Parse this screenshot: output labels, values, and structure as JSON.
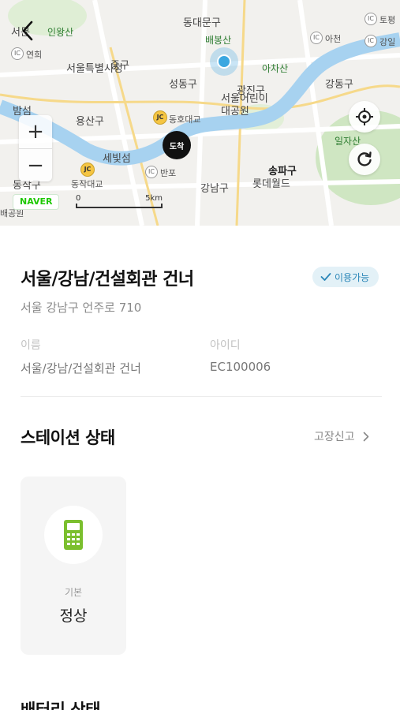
{
  "map": {
    "labels": {
      "dongdaemun": "동대문구",
      "seomun": "서문",
      "inwangsan": "인왕산",
      "baebongsan": "배봉산",
      "ic_yeonhui": "연희",
      "seoulcity": "서울특별시청",
      "junggu": "중구",
      "achasan": "아차산",
      "seongdong": "성동구",
      "gwangjingu": "광진구",
      "childpark": "서울어린이\n대공원",
      "gangdong": "강동구",
      "bamseom": "밤섬",
      "yongsan": "용산구",
      "dongho": "동호대교",
      "ilja": "일자산",
      "sebit": "세빛섬",
      "dongjak": "동작구",
      "dongjakbridge": "동작대교",
      "banpo": "반포",
      "songpa": "송파구",
      "lotteworld": "롯데월드",
      "gangnam": "강남구",
      "baegongwon": "배공원",
      "ic_ajeon": "아천",
      "ic_gangil": "강일",
      "ic_topyeong": "토평"
    },
    "arrive_label": "도착",
    "naver_label": "NAVER",
    "scale_start": "0",
    "scale_end": "5km",
    "zoom_in_label": "+",
    "zoom_out_label": "−"
  },
  "station": {
    "name": "서울/강남/건설회관 건너",
    "status_badge": "이용가능",
    "address": "서울 강남구 언주로 710",
    "name_label": "이름",
    "name_value": "서울/강남/건설회관 건너",
    "id_label": "아이디",
    "id_value": "EC100006"
  },
  "station_status": {
    "title": "스테이션 상태",
    "report_label": "고장신고",
    "card_label": "기본",
    "card_value": "정상"
  },
  "battery_section": {
    "title": "배터리 상태"
  },
  "colors": {
    "accent_blue": "#2a86b8",
    "badge_bg": "#e3f1f7",
    "river": "#a7d2f0",
    "green_icon": "#7bbf2e"
  },
  "icons": {
    "back": "chevron-left-icon",
    "locate": "crosshair-icon",
    "refresh": "refresh-icon",
    "check": "check-icon",
    "report_arrow": "chevron-right-icon",
    "status": "kiosk-icon"
  }
}
